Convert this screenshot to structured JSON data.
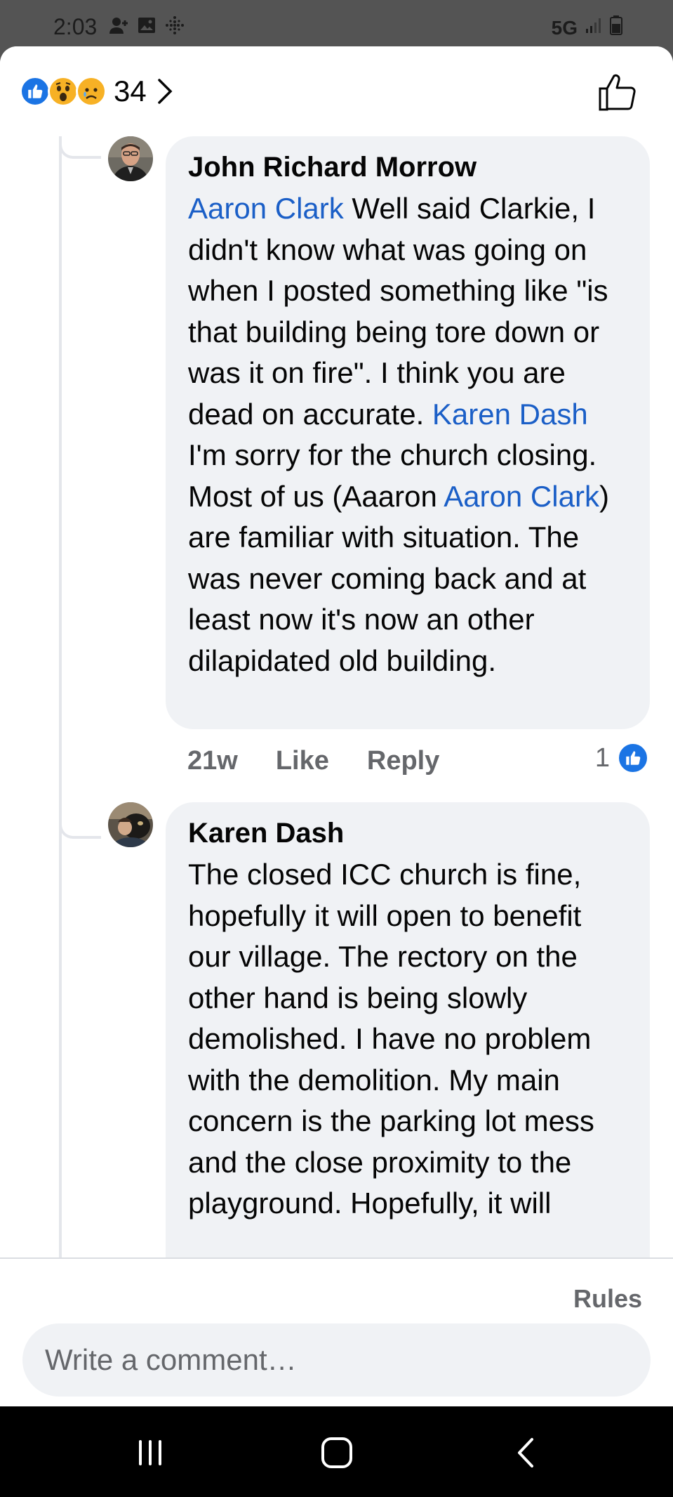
{
  "status_bar": {
    "time": "2:03",
    "network": "5G"
  },
  "reactions": {
    "icons": [
      "like-icon",
      "wow-icon",
      "sad-icon"
    ],
    "count": "34"
  },
  "comments": [
    {
      "author": "John Richard Morrow",
      "segments": [
        {
          "type": "mention",
          "text": "Aaron Clark"
        },
        {
          "type": "text",
          "text": " Well said Clarkie, I didn't know what was going on when I posted something like \"is that building being tore down or was it on fire\".  I think you are dead on accurate. "
        },
        {
          "type": "mention",
          "text": "Karen Dash"
        },
        {
          "type": "text",
          "text": " I'm sorry for the church closing.  Most of us (Aaaron "
        },
        {
          "type": "mention",
          "text": "Aaron Clark"
        },
        {
          "type": "text",
          "text": ") are familiar with situation.  The was  never coming back and at least now it's now an other dilapidated old building."
        }
      ],
      "time": "21w",
      "like_label": "Like",
      "reply_label": "Reply",
      "reaction_count": "1"
    },
    {
      "author": "Karen Dash",
      "body": "The closed ICC church is fine, hopefully it will open to benefit our village. The rectory on the other hand is being slowly demolished. I have no problem with the demolition. My main concern is the parking lot mess and the close proximity to the playground. Hopefully, it will"
    }
  ],
  "composer": {
    "rules_label": "Rules",
    "placeholder": "Write a comment…"
  },
  "colors": {
    "accent": "#1b74e4",
    "mention": "#1b5fc7",
    "bubble": "#f0f2f5",
    "secondary_text": "#65676b"
  }
}
